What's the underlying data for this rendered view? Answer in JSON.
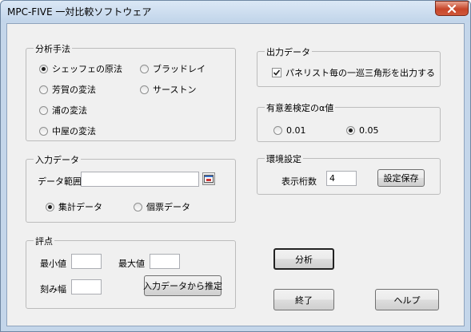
{
  "window": {
    "title": "MPC-FIVE 一対比較ソフトウェア"
  },
  "analysis": {
    "legend": "分析手法",
    "methods": [
      "シェッフェの原法",
      "ブラッドレイ",
      "芳賀の変法",
      "サーストン",
      "浦の変法",
      "中屋の変法"
    ],
    "selected": "シェッフェの原法"
  },
  "input": {
    "legend": "入力データ",
    "range_label": "データ範囲",
    "range_value": "",
    "aggregate_label": "集計データ",
    "individual_label": "個票データ",
    "selected": "集計データ"
  },
  "score": {
    "legend": "評点",
    "min_label": "最小値",
    "min_value": "",
    "max_label": "最大値",
    "max_value": "",
    "step_label": "刻み幅",
    "step_value": "",
    "estimate_button": "入力データから推定"
  },
  "output": {
    "legend": "出力データ",
    "triangle_label": "パネリスト毎の一巡三角形を出力する",
    "triangle_checked": true
  },
  "significance": {
    "legend": "有意差検定のα値",
    "options": [
      "0.01",
      "0.05"
    ],
    "selected": "0.05"
  },
  "env": {
    "legend": "環境設定",
    "digits_label": "表示桁数",
    "digits_value": "4",
    "save_button": "設定保存"
  },
  "actions": {
    "analyze": "分析",
    "exit": "終了",
    "help": "ヘルプ"
  }
}
